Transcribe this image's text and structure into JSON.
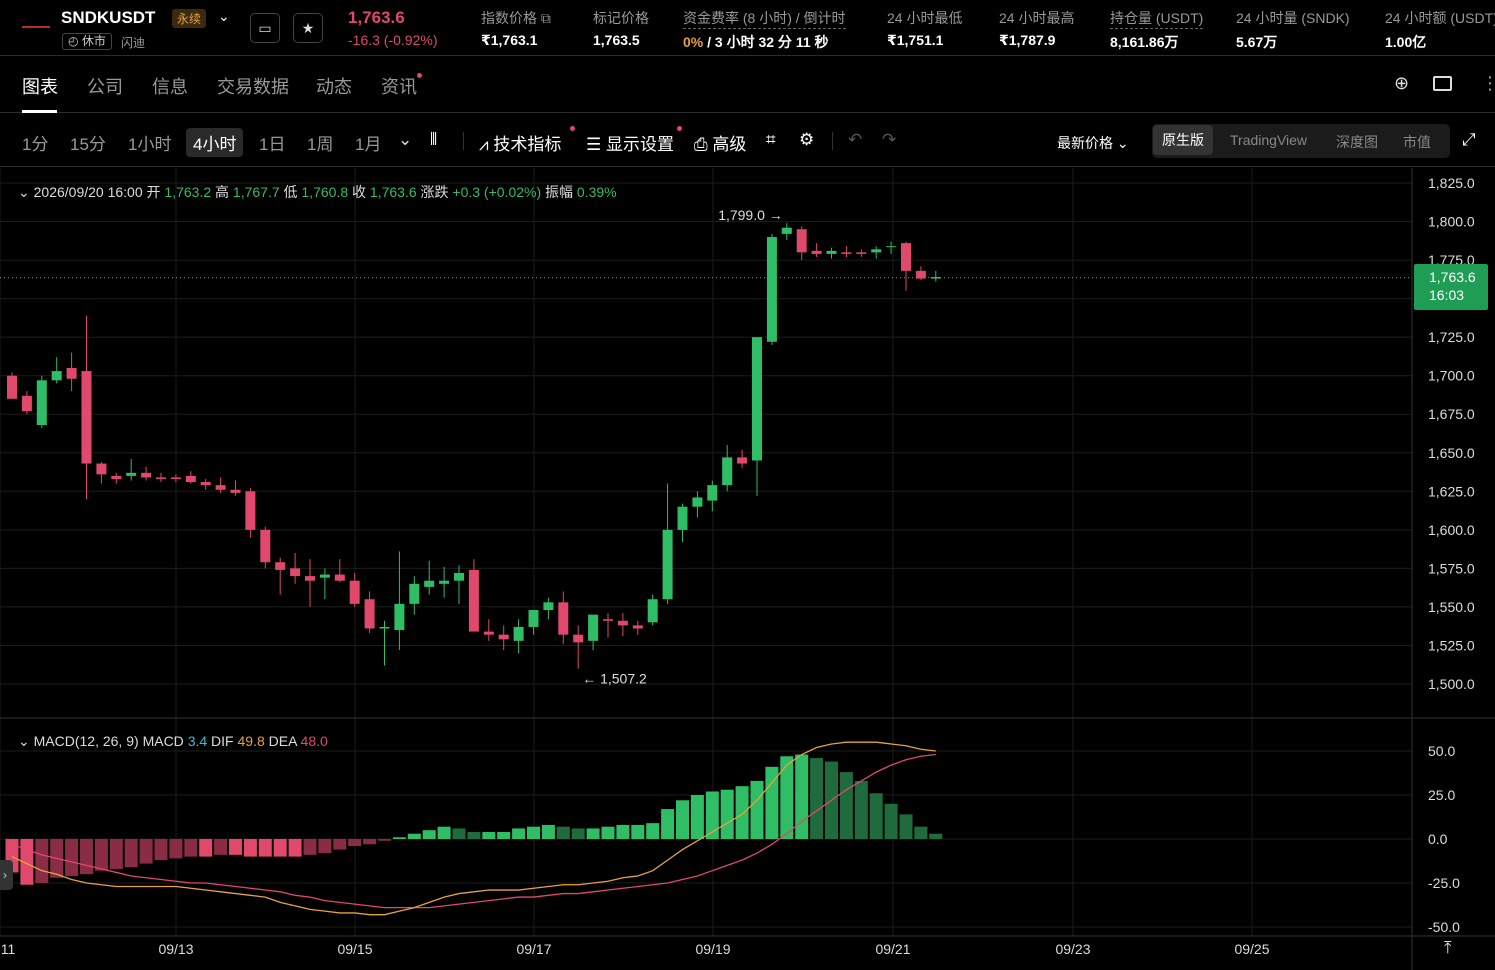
{
  "header": {
    "symbol": "SNDKUSDT",
    "perp_tag": "永续",
    "market_status": "休市",
    "market_sub": "闪迪",
    "price": "1,763.6",
    "change": "-16.3 (-0.92%)",
    "stats": [
      {
        "label": "指数价格",
        "value": "₹1,763.1"
      },
      {
        "label": "标记价格",
        "value": "1,763.5"
      },
      {
        "label": "资金费率 (8 小时) / 倒计时",
        "value_a": "0%",
        "value_b": " / 3 小时 32 分 11 秒"
      },
      {
        "label": "24 小时最低",
        "value": "₹1,751.1"
      },
      {
        "label": "24 小时最高",
        "value": "₹1,787.9"
      },
      {
        "label": "持仓量 (USDT)",
        "value": "8,161.86万"
      },
      {
        "label": "24 小时量 (SNDK)",
        "value": "5.67万"
      },
      {
        "label": "24 小时额 (USDT)",
        "value": "1.00亿"
      }
    ]
  },
  "tabs": [
    "图表",
    "公司",
    "信息",
    "交易数据",
    "动态",
    "资讯"
  ],
  "toolbar": {
    "intervals": [
      "1分",
      "15分",
      "1小时",
      "4小时",
      "1日",
      "1周",
      "1月"
    ],
    "active_interval": "4小时",
    "tools": [
      "技术指标",
      "显示设置",
      "高级"
    ],
    "price_mode": "最新价格",
    "views": [
      "原生版",
      "TradingView",
      "深度图",
      "市值"
    ],
    "active_view": "原生版"
  },
  "ohlc": {
    "date": "2026/09/20 16:00",
    "open_label": "开",
    "open": "1,763.2",
    "high_label": "高",
    "high": "1,767.7",
    "low_label": "低",
    "low": "1,760.8",
    "close_label": "收",
    "close": "1,763.6",
    "chg_label": "涨跌",
    "chg": "+0.3 (+0.02%)",
    "amp_label": "振幅",
    "amp": "0.39%"
  },
  "macd": {
    "name": "MACD(12, 26, 9)",
    "macd_label": "MACD",
    "macd": "3.4",
    "dif_label": "DIF",
    "dif": "49.8",
    "dea_label": "DEA",
    "dea": "48.0"
  },
  "last_price": {
    "price": "1,763.6",
    "time": "16:03"
  },
  "chart_data": {
    "type": "candlestick",
    "y_ticks": [
      "1,825.0",
      "1,800.0",
      "1,775.0",
      "1,750.0",
      "1,725.0",
      "1,700.0",
      "1,675.0",
      "1,650.0",
      "1,625.0",
      "1,600.0",
      "1,575.0",
      "1,550.0",
      "1,525.0",
      "1,500.0"
    ],
    "y_range": [
      1480,
      1830
    ],
    "x_ticks": [
      "11",
      "09/13",
      "09/15",
      "09/17",
      "09/19",
      "09/21",
      "09/23",
      "09/25"
    ],
    "max_label": "1,799.0",
    "min_label": "1,507.2",
    "candles": [
      {
        "o": 1700,
        "h": 1702,
        "l": 1686,
        "c": 1685
      },
      {
        "o": 1687,
        "h": 1690,
        "l": 1675,
        "c": 1677
      },
      {
        "o": 1668,
        "h": 1700,
        "l": 1666,
        "c": 1697
      },
      {
        "o": 1697,
        "h": 1712,
        "l": 1695,
        "c": 1703
      },
      {
        "o": 1705,
        "h": 1715,
        "l": 1690,
        "c": 1698
      },
      {
        "o": 1703,
        "h": 1739,
        "l": 1620,
        "c": 1643
      },
      {
        "o": 1643,
        "h": 1644,
        "l": 1630,
        "c": 1636
      },
      {
        "o": 1635,
        "h": 1637,
        "l": 1630,
        "c": 1633
      },
      {
        "o": 1635,
        "h": 1646,
        "l": 1632,
        "c": 1637
      },
      {
        "o": 1637,
        "h": 1641,
        "l": 1632,
        "c": 1634
      },
      {
        "o": 1634,
        "h": 1637,
        "l": 1631,
        "c": 1633
      },
      {
        "o": 1634,
        "h": 1636,
        "l": 1631,
        "c": 1633
      },
      {
        "o": 1635,
        "h": 1638,
        "l": 1630,
        "c": 1631
      },
      {
        "o": 1631,
        "h": 1633,
        "l": 1626,
        "c": 1629
      },
      {
        "o": 1629,
        "h": 1634,
        "l": 1624,
        "c": 1626
      },
      {
        "o": 1626,
        "h": 1632,
        "l": 1622,
        "c": 1624
      },
      {
        "o": 1625,
        "h": 1627,
        "l": 1595,
        "c": 1600
      },
      {
        "o": 1600,
        "h": 1602,
        "l": 1575,
        "c": 1579
      },
      {
        "o": 1579,
        "h": 1582,
        "l": 1558,
        "c": 1574
      },
      {
        "o": 1575,
        "h": 1585,
        "l": 1565,
        "c": 1570
      },
      {
        "o": 1570,
        "h": 1581,
        "l": 1550,
        "c": 1567
      },
      {
        "o": 1569,
        "h": 1575,
        "l": 1555,
        "c": 1571
      },
      {
        "o": 1571,
        "h": 1581,
        "l": 1566,
        "c": 1567
      },
      {
        "o": 1567,
        "h": 1572,
        "l": 1550,
        "c": 1552
      },
      {
        "o": 1555,
        "h": 1560,
        "l": 1533,
        "c": 1536
      },
      {
        "o": 1536,
        "h": 1541,
        "l": 1512,
        "c": 1537
      },
      {
        "o": 1535,
        "h": 1586,
        "l": 1522,
        "c": 1552
      },
      {
        "o": 1552,
        "h": 1570,
        "l": 1545,
        "c": 1565
      },
      {
        "o": 1563,
        "h": 1580,
        "l": 1558,
        "c": 1567
      },
      {
        "o": 1565,
        "h": 1576,
        "l": 1556,
        "c": 1567
      },
      {
        "o": 1567,
        "h": 1577,
        "l": 1552,
        "c": 1572
      },
      {
        "o": 1574,
        "h": 1581,
        "l": 1546,
        "c": 1534
      },
      {
        "o": 1534,
        "h": 1542,
        "l": 1528,
        "c": 1532
      },
      {
        "o": 1532,
        "h": 1538,
        "l": 1522,
        "c": 1529
      },
      {
        "o": 1528,
        "h": 1542,
        "l": 1520,
        "c": 1537
      },
      {
        "o": 1537,
        "h": 1545,
        "l": 1532,
        "c": 1548
      },
      {
        "o": 1548,
        "h": 1556,
        "l": 1542,
        "c": 1553
      },
      {
        "o": 1553,
        "h": 1560,
        "l": 1526,
        "c": 1532
      },
      {
        "o": 1532,
        "h": 1538,
        "l": 1510,
        "c": 1527
      },
      {
        "o": 1528,
        "h": 1535,
        "l": 1522,
        "c": 1545
      },
      {
        "o": 1542,
        "h": 1546,
        "l": 1530,
        "c": 1541
      },
      {
        "o": 1541,
        "h": 1546,
        "l": 1531,
        "c": 1538
      },
      {
        "o": 1538,
        "h": 1541,
        "l": 1532,
        "c": 1536
      },
      {
        "o": 1540,
        "h": 1558,
        "l": 1538,
        "c": 1555
      },
      {
        "o": 1555,
        "h": 1630,
        "l": 1552,
        "c": 1600
      },
      {
        "o": 1600,
        "h": 1617,
        "l": 1592,
        "c": 1615
      },
      {
        "o": 1615,
        "h": 1625,
        "l": 1608,
        "c": 1621
      },
      {
        "o": 1619,
        "h": 1632,
        "l": 1612,
        "c": 1629
      },
      {
        "o": 1629,
        "h": 1655,
        "l": 1625,
        "c": 1647
      },
      {
        "o": 1647,
        "h": 1652,
        "l": 1640,
        "c": 1643
      },
      {
        "o": 1645,
        "h": 1662,
        "l": 1622,
        "c": 1725
      },
      {
        "o": 1722,
        "h": 1792,
        "l": 1720,
        "c": 1790
      },
      {
        "o": 1792,
        "h": 1799,
        "l": 1788,
        "c": 1796
      },
      {
        "o": 1795,
        "h": 1797,
        "l": 1775,
        "c": 1780
      },
      {
        "o": 1781,
        "h": 1786,
        "l": 1777,
        "c": 1779
      },
      {
        "o": 1779,
        "h": 1783,
        "l": 1776,
        "c": 1781
      },
      {
        "o": 1780,
        "h": 1784,
        "l": 1777,
        "c": 1779
      },
      {
        "o": 1780,
        "h": 1782,
        "l": 1777,
        "c": 1779
      },
      {
        "o": 1780,
        "h": 1784,
        "l": 1776,
        "c": 1782
      },
      {
        "o": 1784,
        "h": 1787,
        "l": 1779,
        "c": 1784
      },
      {
        "o": 1786,
        "h": 1787,
        "l": 1755,
        "c": 1768
      },
      {
        "o": 1768,
        "h": 1771,
        "l": 1762,
        "c": 1763
      },
      {
        "o": 1763,
        "h": 1768,
        "l": 1761,
        "c": 1764
      }
    ],
    "macd_y_ticks": [
      "50.0",
      "25.0",
      "0.0",
      "-25.0",
      "-50.0"
    ],
    "macd_range": [
      -52,
      58
    ],
    "hist": [
      -19,
      -26,
      -25,
      -22,
      -21,
      -20,
      -18,
      -17,
      -16,
      -14,
      -12,
      -11,
      -10,
      -10,
      -9,
      -9,
      -10,
      -10,
      -10,
      -10,
      -9,
      -8,
      -6,
      -4,
      -3,
      -1,
      1,
      3,
      5,
      7,
      6,
      4,
      4,
      4,
      6,
      7,
      8,
      7,
      6,
      6,
      7,
      8,
      8,
      9,
      17,
      22,
      25,
      27,
      28,
      30,
      33,
      41,
      47,
      48,
      46,
      44,
      38,
      33,
      26,
      20,
      14,
      7,
      3
    ],
    "dif": [
      -10,
      -14,
      -18,
      -20,
      -23,
      -25,
      -26,
      -27,
      -27,
      -27,
      -27,
      -27,
      -28,
      -29,
      -30,
      -31,
      -32,
      -33,
      -36,
      -38,
      -40,
      -41,
      -42,
      -42,
      -43,
      -43,
      -41,
      -39,
      -36,
      -33,
      -31,
      -30,
      -29,
      -29,
      -29,
      -28,
      -27,
      -26,
      -26,
      -25,
      -24,
      -22,
      -21,
      -18,
      -12,
      -6,
      -1,
      4,
      9,
      14,
      22,
      32,
      42,
      48,
      52,
      54,
      55,
      55,
      55,
      54,
      53,
      51,
      50
    ],
    "dea": [
      -3,
      -6,
      -9,
      -11,
      -13,
      -15,
      -17,
      -19,
      -21,
      -22,
      -23,
      -24,
      -25,
      -25,
      -26,
      -27,
      -28,
      -29,
      -30,
      -32,
      -33,
      -35,
      -36,
      -37,
      -38,
      -39,
      -39,
      -39,
      -39,
      -38,
      -37,
      -36,
      -35,
      -34,
      -33,
      -33,
      -32,
      -31,
      -31,
      -30,
      -29,
      -28,
      -27,
      -26,
      -25,
      -23,
      -21,
      -18,
      -15,
      -12,
      -8,
      -3,
      3,
      10,
      16,
      22,
      28,
      33,
      38,
      42,
      45,
      47,
      48
    ]
  }
}
